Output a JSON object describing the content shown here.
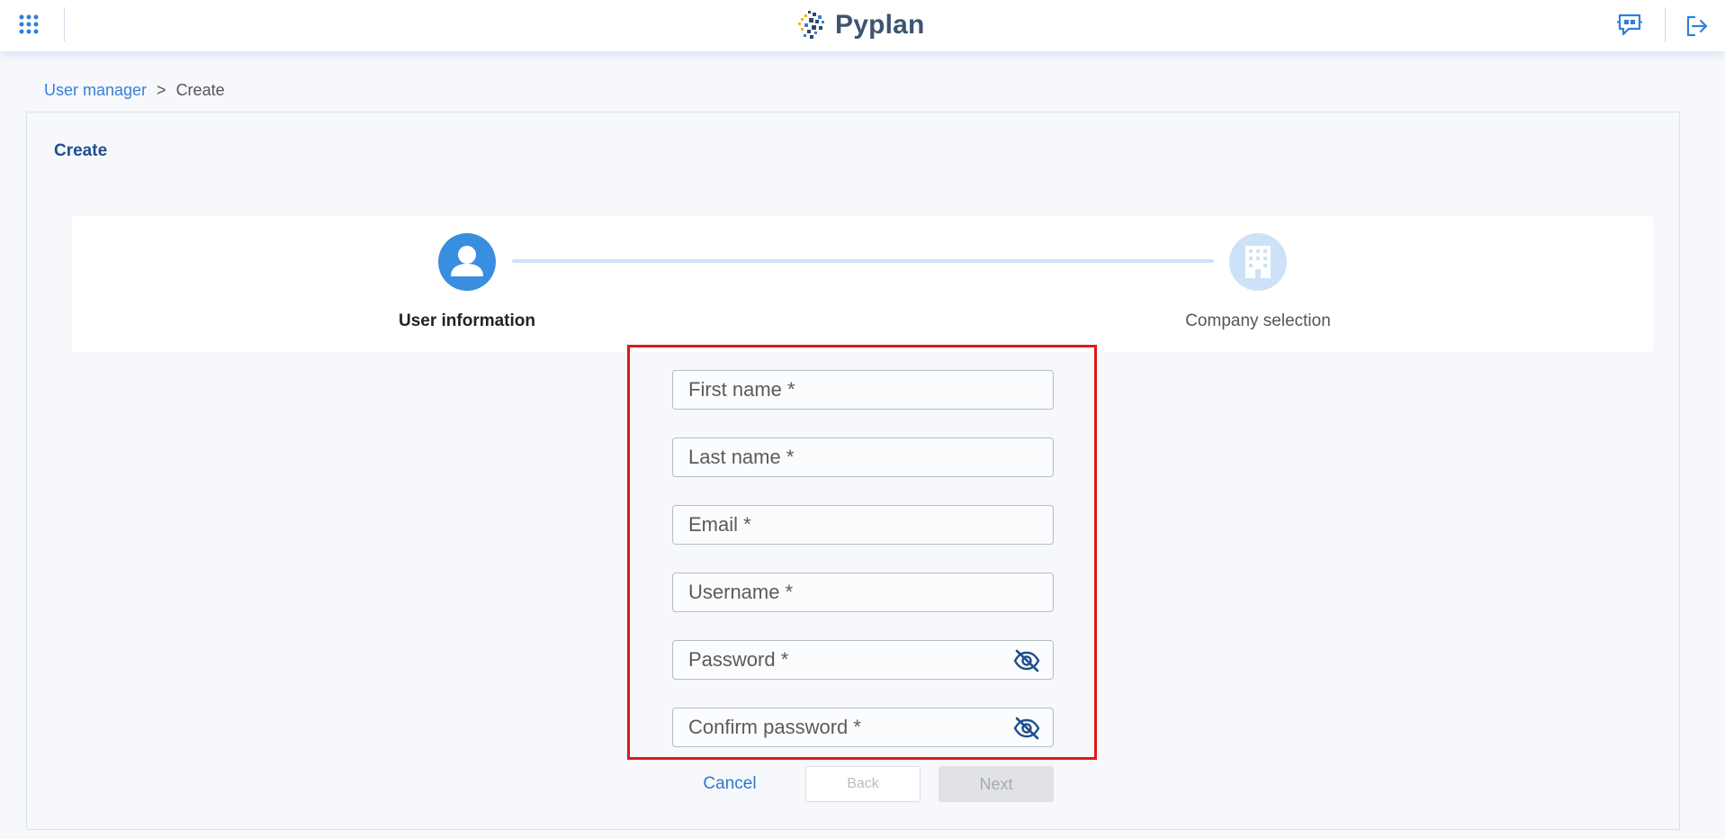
{
  "app": {
    "logo_text": "Pyplan"
  },
  "header": {
    "apps_icon": "grid-dots-icon",
    "chat_icon": "chat-bubble-icon",
    "logout_icon": "logout-icon",
    "accent_color": "#2f80d8"
  },
  "breadcrumb": {
    "parent": "User manager",
    "separator": ">",
    "current": "Create"
  },
  "panel": {
    "title": "Create"
  },
  "stepper": {
    "steps": [
      {
        "label": "User information",
        "icon": "user-icon",
        "state": "active"
      },
      {
        "label": "Company selection",
        "icon": "building-icon",
        "state": "inactive"
      }
    ]
  },
  "form": {
    "first_name": {
      "placeholder": "First name *"
    },
    "last_name": {
      "placeholder": "Last name *"
    },
    "email": {
      "placeholder": "Email *"
    },
    "username": {
      "placeholder": "Username *"
    },
    "password": {
      "placeholder": "Password *",
      "toggle_icon": "eye-off-icon"
    },
    "confirm_password": {
      "placeholder": "Confirm password *",
      "toggle_icon": "eye-off-icon"
    }
  },
  "actions": {
    "cancel": "Cancel",
    "back": "Back",
    "next": "Next"
  },
  "colors": {
    "highlight": "#e11919",
    "active_step": "#3a8ee0",
    "inactive_step": "#cde2f7"
  }
}
